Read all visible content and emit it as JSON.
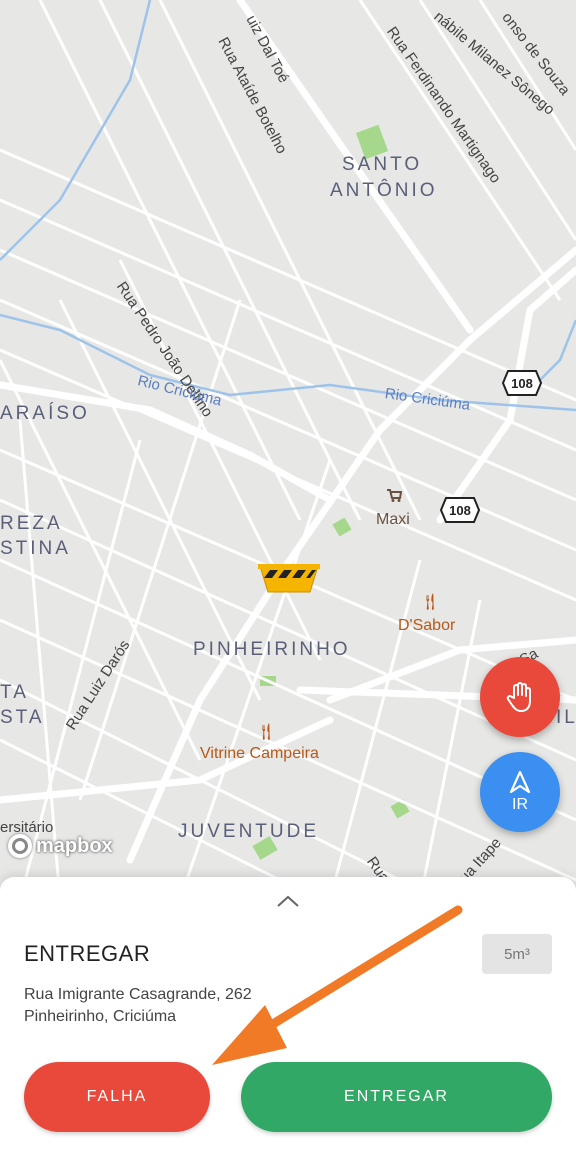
{
  "map": {
    "streets": [
      "uiz Dal Toé",
      "Rua Ataíde Botelho",
      "Rua Ferdinando Martignago",
      "nábile Milanez Sônego",
      "onso de Souza",
      "Rua Pedro João Delfino",
      "Rua Luiz Darós",
      "Rua Pa",
      "Rua Itape",
      "nida Sa"
    ],
    "neighborhoods": [
      "SANTO",
      "ANTÔNIO",
      "ARAÍSO",
      "REZA",
      "STINA",
      "PINHEIRINHO",
      "JUVENTUDE",
      "TA",
      "STA",
      "IL"
    ],
    "rivers": [
      "Rio Criciúma",
      "Rio Criciúma"
    ],
    "pois": [
      "Maxi",
      "D'Sabor",
      "Vitrine Campeira",
      "ersitário"
    ],
    "route_shields": [
      "108",
      "108"
    ],
    "attribution": "mapbox"
  },
  "fab": {
    "stop_icon": "hand-icon",
    "go_label": "IR",
    "go_icon": "navigation-arrow-icon"
  },
  "sheet": {
    "title": "ENTREGAR",
    "volume": "5m³",
    "address_line1": "Rua Imigrante Casagrande, 262",
    "address_line2": "Pinheirinho, Criciúma",
    "fail_label": "FALHA",
    "deliver_label": "ENTREGAR"
  },
  "colors": {
    "fail": "#e8493a",
    "deliver": "#31a865",
    "go": "#3a8ff0",
    "annotation_arrow": "#f07a26"
  }
}
